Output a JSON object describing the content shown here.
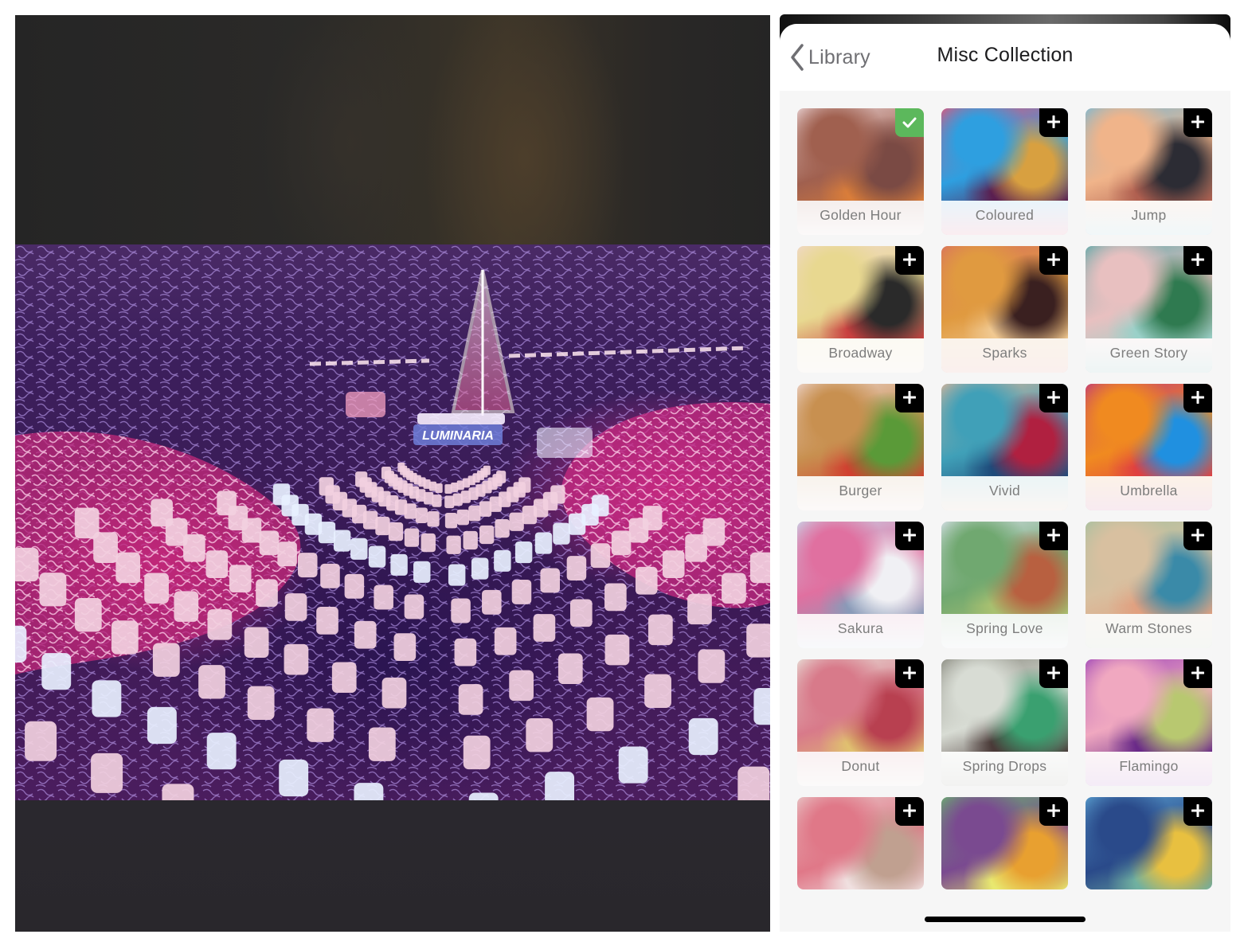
{
  "preview": {
    "photo_caption_text": "LUMINARIA",
    "description": "Luminaria lantern display with lit sailboat, stylized filter applied"
  },
  "navbar": {
    "back_label": "Library",
    "back_icon": "chevron-left-icon",
    "title": "Misc Collection"
  },
  "filters": [
    {
      "name": "Golden Hour",
      "state": "selected",
      "badge_icon": "checkmark-icon",
      "colors": [
        "#e9d3d4",
        "#a0604f",
        "#7a4a44",
        "#d97d3a"
      ]
    },
    {
      "name": "Coloured",
      "state": "add",
      "badge_icon": "plus-icon",
      "colors": [
        "#e2567a",
        "#2e9fe0",
        "#d8a040",
        "#5a1f50"
      ]
    },
    {
      "name": "Jump",
      "state": "add",
      "badge_icon": "plus-icon",
      "colors": [
        "#7db8d2",
        "#f0b48a",
        "#2c2c34",
        "#b06050"
      ]
    },
    {
      "name": "Broadway",
      "state": "add",
      "badge_icon": "plus-icon",
      "colors": [
        "#f0d8c8",
        "#e8d890",
        "#2a2a2a",
        "#c84040"
      ]
    },
    {
      "name": "Sparks",
      "state": "add",
      "badge_icon": "plus-icon",
      "colors": [
        "#d9735e",
        "#e09a40",
        "#3a2020",
        "#f0c890"
      ]
    },
    {
      "name": "Green Story",
      "state": "add",
      "badge_icon": "plus-icon",
      "colors": [
        "#5fa8a8",
        "#e8c0c0",
        "#2f7a50",
        "#9ad0c8"
      ]
    },
    {
      "name": "Burger",
      "state": "add",
      "badge_icon": "plus-icon",
      "colors": [
        "#edd4cc",
        "#c89050",
        "#5a9a38",
        "#d04030"
      ]
    },
    {
      "name": "Vivid",
      "state": "add",
      "badge_icon": "plus-icon",
      "colors": [
        "#d8b49a",
        "#40a0b8",
        "#b02040",
        "#1e4a7a"
      ]
    },
    {
      "name": "Umbrella",
      "state": "add",
      "badge_icon": "plus-icon",
      "colors": [
        "#c03a7a",
        "#f08a20",
        "#2090e0",
        "#e04040"
      ]
    },
    {
      "name": "Sakura",
      "state": "add",
      "badge_icon": "plus-icon",
      "colors": [
        "#c8d4e8",
        "#e070a0",
        "#f0f0f4",
        "#8a9ab8"
      ]
    },
    {
      "name": "Spring Love",
      "state": "add",
      "badge_icon": "plus-icon",
      "colors": [
        "#d8e0ea",
        "#70a870",
        "#b86040",
        "#a8c070"
      ]
    },
    {
      "name": "Warm Stones",
      "state": "add",
      "badge_icon": "plus-icon",
      "colors": [
        "#a8c0a0",
        "#d8c0a0",
        "#3a8aa8",
        "#e0a080"
      ]
    },
    {
      "name": "Donut",
      "state": "add",
      "badge_icon": "plus-icon",
      "colors": [
        "#e8e0d8",
        "#d87a8a",
        "#b84050",
        "#e0c070"
      ]
    },
    {
      "name": "Spring Drops",
      "state": "add",
      "badge_icon": "plus-icon",
      "colors": [
        "#8a8a80",
        "#d8dcd4",
        "#3aa070",
        "#4a3a38"
      ]
    },
    {
      "name": "Flamingo",
      "state": "add",
      "badge_icon": "plus-icon",
      "colors": [
        "#a048b8",
        "#f0a8c0",
        "#b8c870",
        "#6a2a88"
      ]
    },
    {
      "name": "",
      "state": "add",
      "badge_icon": "plus-icon",
      "colors": [
        "#e8c8c8",
        "#e07888",
        "#c0a090",
        "#f0e0e0"
      ]
    },
    {
      "name": "",
      "state": "add",
      "badge_icon": "plus-icon",
      "colors": [
        "#6ab070",
        "#7a4a90",
        "#e8a030",
        "#e8e870"
      ]
    },
    {
      "name": "",
      "state": "add",
      "badge_icon": "plus-icon",
      "colors": [
        "#5aa0d0",
        "#2a4a8a",
        "#e8c040",
        "#70b0a0"
      ]
    }
  ]
}
